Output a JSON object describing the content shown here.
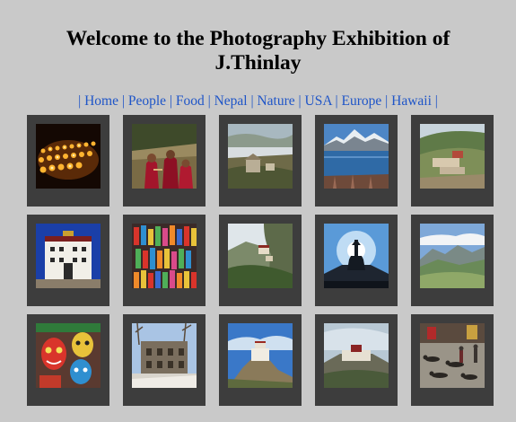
{
  "header": {
    "title_line1": "Welcome to the Photography Exhibition of",
    "title_line2": "J.Thinlay"
  },
  "nav": {
    "separator": "|",
    "items": [
      {
        "label": "Home"
      },
      {
        "label": "People"
      },
      {
        "label": "Food"
      },
      {
        "label": "Nepal"
      },
      {
        "label": "Nature"
      },
      {
        "label": "USA"
      },
      {
        "label": "Europe"
      },
      {
        "label": "Hawaii"
      }
    ]
  },
  "colors": {
    "background": "#c9c9c9",
    "tile": "#3d3d3d",
    "link": "#1f55c8"
  },
  "gallery": {
    "thumbnails": [
      {
        "subject": "butter-lamps"
      },
      {
        "subject": "monks"
      },
      {
        "subject": "valley-village"
      },
      {
        "subject": "mountain-lake"
      },
      {
        "subject": "hillside-monastery"
      },
      {
        "subject": "white-palace"
      },
      {
        "subject": "market-crafts"
      },
      {
        "subject": "cliff-monastery"
      },
      {
        "subject": "stupa-silhouette"
      },
      {
        "subject": "mountain-valley"
      },
      {
        "subject": "masks"
      },
      {
        "subject": "ruined-buildings"
      },
      {
        "subject": "hill-fortress"
      },
      {
        "subject": "potala-palace"
      },
      {
        "subject": "pilgrims-prostrating"
      }
    ]
  }
}
